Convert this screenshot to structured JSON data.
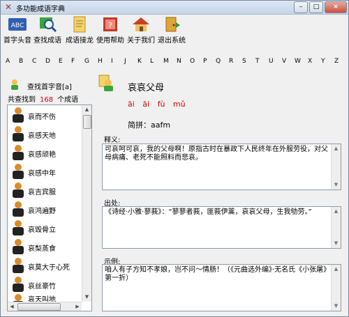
{
  "window": {
    "title": "多功能成语字典",
    "buttons": [
      "–",
      "□",
      "×"
    ]
  },
  "toolbar": [
    {
      "label": "首字头音",
      "icon": "abc-letters-icon"
    },
    {
      "label": "查找成语",
      "icon": "magnifier-search-icon"
    },
    {
      "label": "成语接龙",
      "icon": "notepad-pencil-icon"
    },
    {
      "label": "使用帮助",
      "icon": "help-book-icon"
    },
    {
      "label": "关于我们",
      "icon": "house-icon"
    },
    {
      "label": "退出系统",
      "icon": "exit-door-icon"
    }
  ],
  "letters": [
    "A",
    "B",
    "C",
    "D",
    "E",
    "F",
    "G",
    "H",
    "I",
    "J",
    "K",
    "L",
    "M",
    "N",
    "O",
    "P",
    "Q",
    "R",
    "S",
    "T",
    "U",
    "V",
    "W",
    "X",
    "Y",
    "Z"
  ],
  "search": {
    "label": "查找首字音[a]"
  },
  "results": {
    "prefix": "共查找到",
    "count": "168",
    "suffix": "个成语"
  },
  "list_items": [
    "哀而不伤",
    "哀感天地",
    "哀感顽艳",
    "哀感中年",
    "哀吉宾服",
    "哀鸿遍野",
    "哀毁骨立",
    "哀梨蒸食",
    "哀莫大于心死",
    "哀丝豪竹",
    "哀天叫地"
  ],
  "idiom": {
    "title": "哀哀父母",
    "pinyin": "āi āi fù mǔ",
    "abbr": "简拼：aafm",
    "meaning_label": "释义:",
    "meaning": "可哀呵可哀，我的父母啊！原指古时在暴政下人民终年在外服劳役，对父母病痛、老死不能照料而悲哀。",
    "source_label": "出处:",
    "source": "《诗经·小雅·蓼莪》：“蓼蓼者莪，匪莪伊蒿，哀哀父母，生我劬劳。”",
    "example_label": "示例:",
    "example": "咱人有子方知不孝娘，岂不问～情肠！（《元曲选外编》·无名氏《小张屠》第一折）"
  },
  "colors": {
    "count": "#d40000",
    "pinyin": "#d40000",
    "title_bar": "#c6d5e8"
  }
}
